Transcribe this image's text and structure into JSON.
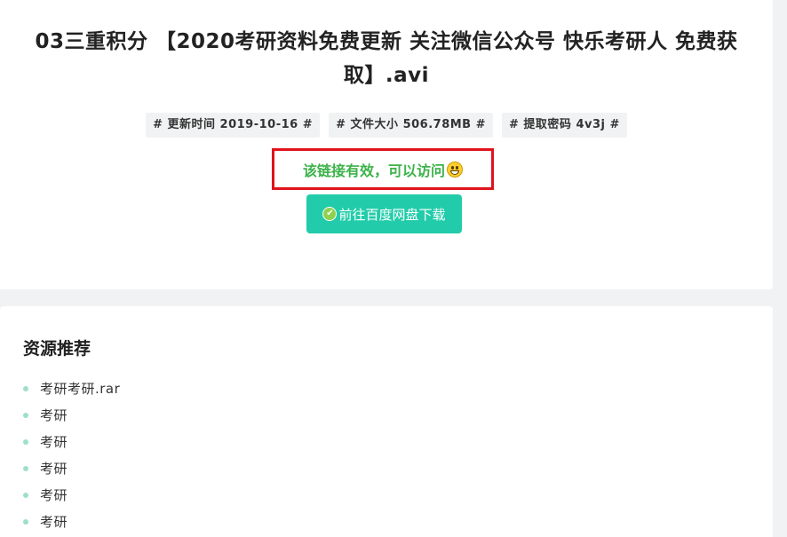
{
  "title": "03三重积分 【2020考研资料免费更新 关注微信公众号 快乐考研人 免费获取】.avi",
  "meta": [
    "# 更新时间 2019-10-16 #",
    "# 文件大小 506.78MB #",
    "# 提取密码 4v3j #"
  ],
  "status": {
    "text": "该链接有效，可以访问",
    "icon": "grinning-emoji-icon"
  },
  "download": {
    "label": "前往百度网盘下载",
    "icon": "check-circle-icon"
  },
  "recommend": {
    "heading": "资源推荐",
    "items": [
      "考研考研.rar",
      "考研",
      "考研",
      "考研",
      "考研",
      "考研"
    ]
  },
  "colors": {
    "status_text": "#3cb24a",
    "status_border": "#e0131d",
    "button": "#22ccaa",
    "bullet": "#9fdfca"
  }
}
